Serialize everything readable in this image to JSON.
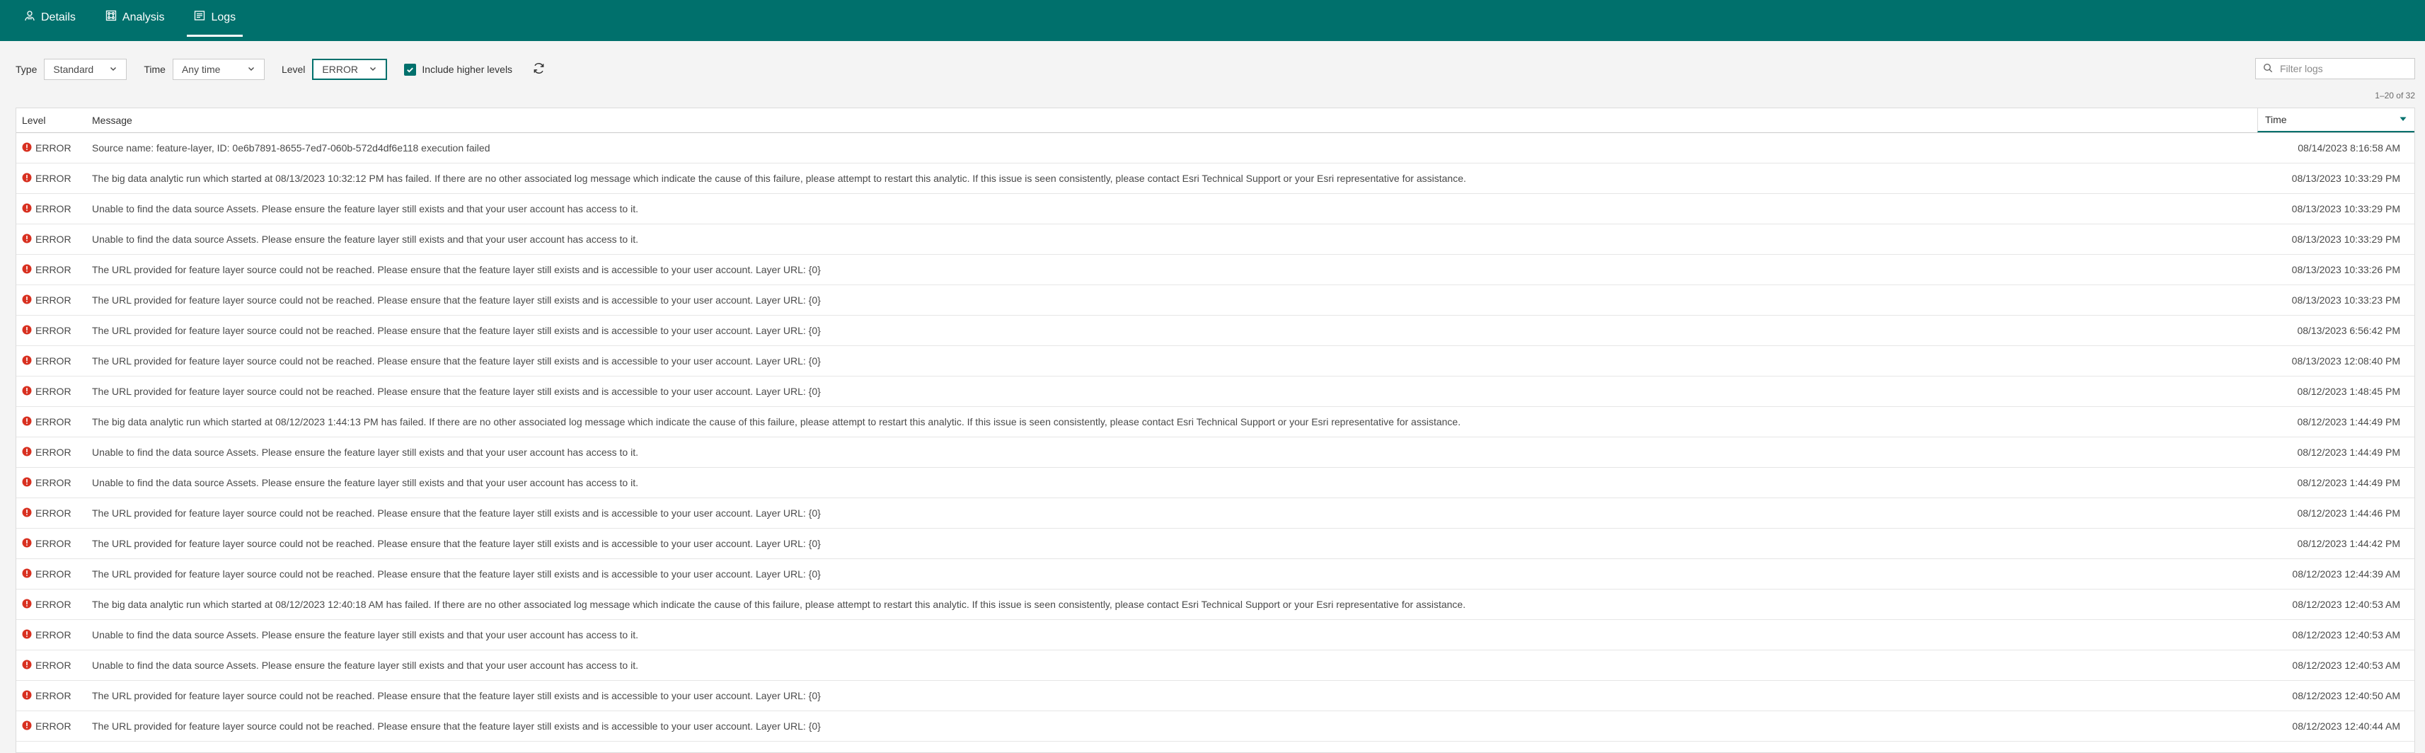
{
  "nav": {
    "tabs": [
      {
        "label": "Details",
        "icon": "details-icon"
      },
      {
        "label": "Analysis",
        "icon": "analysis-icon"
      },
      {
        "label": "Logs",
        "icon": "logs-icon",
        "active": true
      }
    ]
  },
  "filters": {
    "type_label": "Type",
    "type_value": "Standard",
    "time_label": "Time",
    "time_value": "Any time",
    "level_label": "Level",
    "level_value": "ERROR",
    "include_higher_label": "Include higher levels",
    "include_higher_checked": true,
    "search_placeholder": "Filter logs"
  },
  "pager": {
    "text": "1–20 of 32"
  },
  "table": {
    "columns": {
      "level": "Level",
      "message": "Message",
      "time": "Time"
    },
    "rows": [
      {
        "level": "ERROR",
        "message": "Source name: feature-layer, ID: 0e6b7891-8655-7ed7-060b-572d4df6e118 execution failed",
        "time": "08/14/2023 8:16:58 AM"
      },
      {
        "level": "ERROR",
        "message": "The big data analytic run which started at 08/13/2023 10:32:12 PM has failed. If there are no other associated log message which indicate the cause of this failure, please attempt to restart this analytic. If this issue is seen consistently, please contact Esri Technical Support or your Esri representative for assistance.",
        "time": "08/13/2023 10:33:29 PM"
      },
      {
        "level": "ERROR",
        "message": "Unable to find the data source Assets. Please ensure the feature layer still exists and that your user account has access to it.",
        "time": "08/13/2023 10:33:29 PM"
      },
      {
        "level": "ERROR",
        "message": "Unable to find the data source Assets. Please ensure the feature layer still exists and that your user account has access to it.",
        "time": "08/13/2023 10:33:29 PM"
      },
      {
        "level": "ERROR",
        "message": "The URL provided for feature layer source could not be reached. Please ensure that the feature layer still exists and is accessible to your user account. Layer URL: {0}",
        "time": "08/13/2023 10:33:26 PM"
      },
      {
        "level": "ERROR",
        "message": "The URL provided for feature layer source could not be reached. Please ensure that the feature layer still exists and is accessible to your user account. Layer URL: {0}",
        "time": "08/13/2023 10:33:23 PM"
      },
      {
        "level": "ERROR",
        "message": "The URL provided for feature layer source could not be reached. Please ensure that the feature layer still exists and is accessible to your user account. Layer URL: {0}",
        "time": "08/13/2023 6:56:42 PM"
      },
      {
        "level": "ERROR",
        "message": "The URL provided for feature layer source could not be reached. Please ensure that the feature layer still exists and is accessible to your user account. Layer URL: {0}",
        "time": "08/13/2023 12:08:40 PM"
      },
      {
        "level": "ERROR",
        "message": "The URL provided for feature layer source could not be reached. Please ensure that the feature layer still exists and is accessible to your user account. Layer URL: {0}",
        "time": "08/12/2023 1:48:45 PM"
      },
      {
        "level": "ERROR",
        "message": "The big data analytic run which started at 08/12/2023 1:44:13 PM has failed. If there are no other associated log message which indicate the cause of this failure, please attempt to restart this analytic. If this issue is seen consistently, please contact Esri Technical Support or your Esri representative for assistance.",
        "time": "08/12/2023 1:44:49 PM"
      },
      {
        "level": "ERROR",
        "message": "Unable to find the data source Assets. Please ensure the feature layer still exists and that your user account has access to it.",
        "time": "08/12/2023 1:44:49 PM"
      },
      {
        "level": "ERROR",
        "message": "Unable to find the data source Assets. Please ensure the feature layer still exists and that your user account has access to it.",
        "time": "08/12/2023 1:44:49 PM"
      },
      {
        "level": "ERROR",
        "message": "The URL provided for feature layer source could not be reached. Please ensure that the feature layer still exists and is accessible to your user account. Layer URL: {0}",
        "time": "08/12/2023 1:44:46 PM"
      },
      {
        "level": "ERROR",
        "message": "The URL provided for feature layer source could not be reached. Please ensure that the feature layer still exists and is accessible to your user account. Layer URL: {0}",
        "time": "08/12/2023 1:44:42 PM"
      },
      {
        "level": "ERROR",
        "message": "The URL provided for feature layer source could not be reached. Please ensure that the feature layer still exists and is accessible to your user account. Layer URL: {0}",
        "time": "08/12/2023 12:44:39 AM"
      },
      {
        "level": "ERROR",
        "message": "The big data analytic run which started at 08/12/2023 12:40:18 AM has failed. If there are no other associated log message which indicate the cause of this failure, please attempt to restart this analytic. If this issue is seen consistently, please contact Esri Technical Support or your Esri representative for assistance.",
        "time": "08/12/2023 12:40:53 AM"
      },
      {
        "level": "ERROR",
        "message": "Unable to find the data source Assets. Please ensure the feature layer still exists and that your user account has access to it.",
        "time": "08/12/2023 12:40:53 AM"
      },
      {
        "level": "ERROR",
        "message": "Unable to find the data source Assets. Please ensure the feature layer still exists and that your user account has access to it.",
        "time": "08/12/2023 12:40:53 AM"
      },
      {
        "level": "ERROR",
        "message": "The URL provided for feature layer source could not be reached. Please ensure that the feature layer still exists and is accessible to your user account. Layer URL: {0}",
        "time": "08/12/2023 12:40:50 AM"
      },
      {
        "level": "ERROR",
        "message": "The URL provided for feature layer source could not be reached. Please ensure that the feature layer still exists and is accessible to your user account. Layer URL: {0}",
        "time": "08/12/2023 12:40:44 AM"
      }
    ]
  },
  "colors": {
    "header_bg": "#00706c",
    "error_red": "#d83020",
    "accent": "#00706c"
  }
}
